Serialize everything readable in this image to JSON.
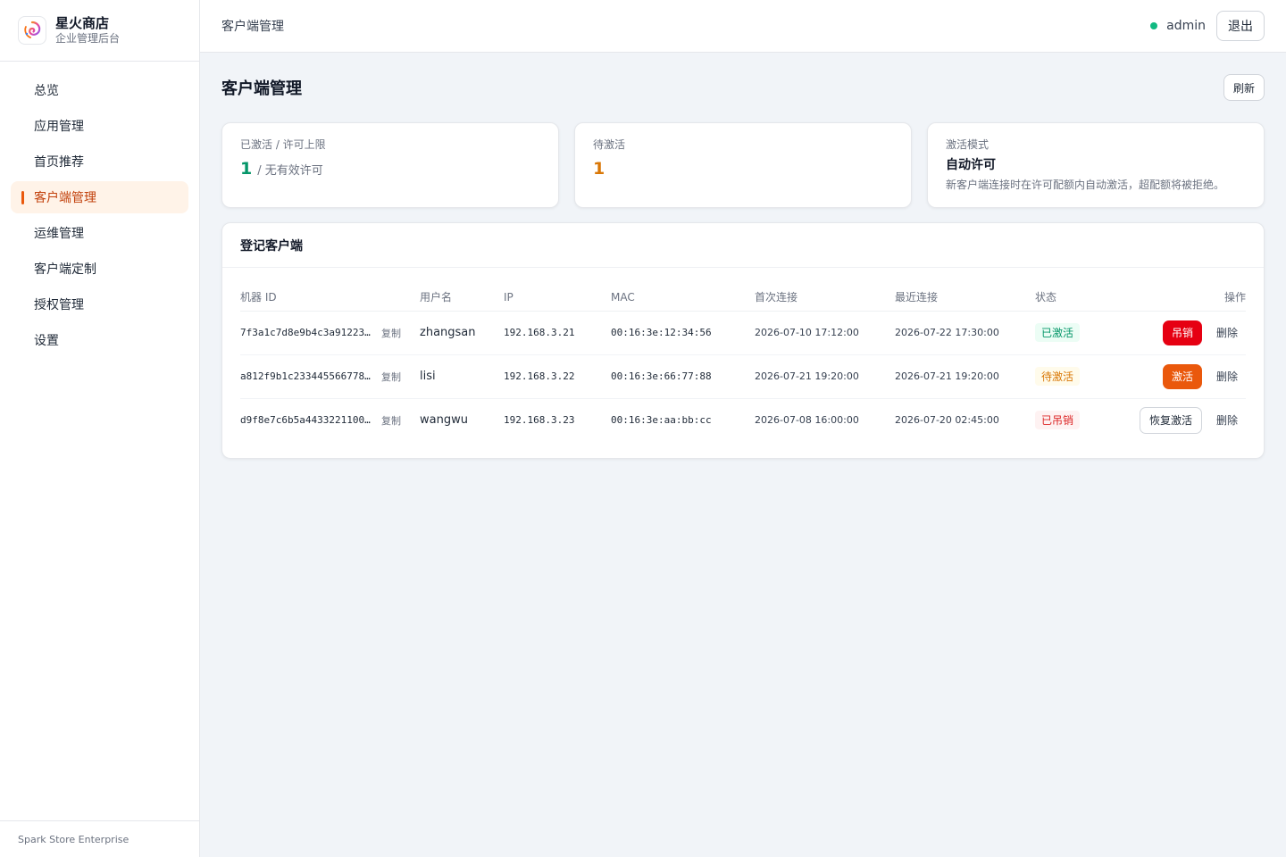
{
  "brand": {
    "name": "星火商店",
    "subtitle": "企业管理后台"
  },
  "sidebar": {
    "items": [
      {
        "label": "总览",
        "active": false
      },
      {
        "label": "应用管理",
        "active": false
      },
      {
        "label": "首页推荐",
        "active": false
      },
      {
        "label": "客户端管理",
        "active": true
      },
      {
        "label": "运维管理",
        "active": false
      },
      {
        "label": "客户端定制",
        "active": false
      },
      {
        "label": "授权管理",
        "active": false
      },
      {
        "label": "设置",
        "active": false
      }
    ],
    "footer": "Spark Store Enterprise"
  },
  "topbar": {
    "title": "客户端管理",
    "user": "admin",
    "logout_label": "退出",
    "status_color": "#10b981"
  },
  "page": {
    "title": "客户端管理",
    "refresh_label": "刷新"
  },
  "stats": {
    "activated": {
      "label": "已激活 / 许可上限",
      "value": "1",
      "suffix": "/ 无有效许可"
    },
    "pending": {
      "label": "待激活",
      "value": "1"
    },
    "mode": {
      "label": "激活模式",
      "value": "自动许可",
      "desc": "新客户端连接时在许可配额内自动激活，超配额将被拒绝。"
    }
  },
  "clients": {
    "title": "登记客户端",
    "columns": [
      "机器 ID",
      "用户名",
      "IP",
      "MAC",
      "首次连接",
      "最近连接",
      "状态",
      "操作"
    ],
    "copy_label": "复制",
    "delete_label": "删除",
    "rows": [
      {
        "machine_id": "7f3a1c7d8e9b4c3a91223…",
        "username": "zhangsan",
        "ip": "192.168.3.21",
        "mac": "00:16:3e:12:34:56",
        "first": "2026-07-10 17:12:00",
        "last": "2026-07-22 17:30:00",
        "status": "已激活",
        "action": "吊销"
      },
      {
        "machine_id": "a812f9b1c233445566778…",
        "username": "lisi",
        "ip": "192.168.3.22",
        "mac": "00:16:3e:66:77:88",
        "first": "2026-07-21 19:20:00",
        "last": "2026-07-21 19:20:00",
        "status": "待激活",
        "action": "激活"
      },
      {
        "machine_id": "d9f8e7c6b5a4433221100…",
        "username": "wangwu",
        "ip": "192.168.3.23",
        "mac": "00:16:3e:aa:bb:cc",
        "first": "2026-07-08 16:00:00",
        "last": "2026-07-20 02:45:00",
        "status": "已吊销",
        "action": "恢复激活"
      }
    ]
  },
  "colors": {
    "accent": "#ea580c",
    "danger": "#e60012",
    "success": "#059669",
    "warning": "#d97706"
  }
}
